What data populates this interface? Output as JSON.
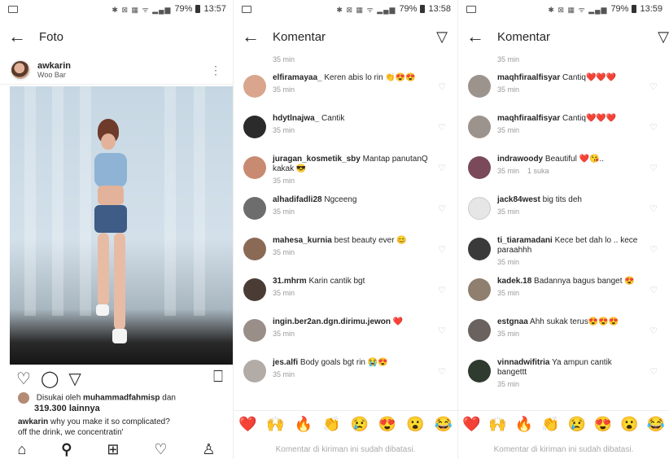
{
  "status": {
    "panel1": {
      "battery": "79%",
      "time": "13:57"
    },
    "panel2": {
      "battery": "79%",
      "time": "13:58"
    },
    "panel3": {
      "battery": "79%",
      "time": "13:59"
    }
  },
  "panel1": {
    "title": "Foto",
    "post": {
      "username": "awkarin",
      "location": "Woo Bar",
      "liked_by_prefix": "Disukai oleh",
      "liked_by_user": "muhammadfahmisp",
      "liked_by_and": "dan",
      "likes_count": "319.300 lainnya",
      "caption_user": "awkarin",
      "caption_text": "why you make it so complicated?",
      "caption_line2": "off the drink, we concentratin'"
    }
  },
  "panel2": {
    "title": "Komentar",
    "partial_time": "35 min",
    "comments": [
      {
        "user": "elfiramayaa_",
        "text": "Keren abis lo rin 👏😍😍",
        "time": "35 min",
        "avatar_color": "#d9a58c"
      },
      {
        "user": "hdytlnajwa_",
        "text": "Cantik",
        "time": "35 min",
        "avatar_color": "#2b2b2b"
      },
      {
        "user": "juragan_kosmetik_sby",
        "text": "Mantap panutanQ kakak 😎",
        "time": "35 min",
        "avatar_color": "#c98a72"
      },
      {
        "user": "alhadifadli28",
        "text": "Ngceeng",
        "time": "35 min",
        "avatar_color": "#6d6d6d"
      },
      {
        "user": "mahesa_kurnia",
        "text": "best beauty ever 😊",
        "time": "35 min",
        "avatar_color": "#8a6a55"
      },
      {
        "user": "31.mhrm",
        "text": "Karin cantik bgt",
        "time": "35 min",
        "avatar_color": "#4a3b35"
      },
      {
        "user": "ingin.ber2an.dgn.dirimu.jewon",
        "text": "❤️",
        "time": "35 min",
        "avatar_color": "#9a8e88"
      },
      {
        "user": "jes.alfi",
        "text": "Body goals bgt rin 😭😍",
        "time": "35 min",
        "avatar_color": "#b3aba6"
      }
    ],
    "emojis": [
      "❤️",
      "🙌",
      "🔥",
      "👏",
      "😢",
      "😍",
      "😮",
      "😂"
    ],
    "disabled_note": "Komentar di kiriman ini sudah dibatasi."
  },
  "panel3": {
    "title": "Komentar",
    "partial_time": "35 min",
    "comments": [
      {
        "user": "maqhfiraalfisyar",
        "text": "Cantiq❤️❤️❤️",
        "time": "35 min",
        "likes": "",
        "avatar_color": "#9d938d"
      },
      {
        "user": "maqhfiraalfisyar",
        "text": "Cantiq❤️❤️❤️",
        "time": "35 min",
        "likes": "",
        "avatar_color": "#9d938d"
      },
      {
        "user": "indrawoody",
        "text": "Beautiful ❤️😘..",
        "time": "35 min",
        "likes": "1 suka",
        "avatar_color": "#7a4a5a"
      },
      {
        "user": "jack84west",
        "text": "big tits deh",
        "time": "35 min",
        "likes": "",
        "avatar_color": "#e6e6e6"
      },
      {
        "user": "ti_tiaramadani",
        "text": "Kece bet dah lo .. kece paraahhh",
        "time": "35 min",
        "likes": "",
        "avatar_color": "#3a3a3a"
      },
      {
        "user": "kadek.18",
        "text": "Badannya bagus banget 😍",
        "time": "35 min",
        "likes": "",
        "avatar_color": "#8f7f6f"
      },
      {
        "user": "estgnaa",
        "text": "Ahh sukak terus😍😍😍",
        "time": "35 min",
        "likes": "",
        "avatar_color": "#6a625e"
      },
      {
        "user": "vinnadwifitria",
        "text": "Ya ampun cantik bangettt",
        "time": "35 min",
        "likes": "",
        "avatar_color": "#2e3b2e"
      }
    ],
    "emojis": [
      "❤️",
      "🙌",
      "🔥",
      "👏",
      "😢",
      "😍",
      "😮",
      "😂"
    ],
    "disabled_note": "Komentar di kiriman ini sudah dibatasi."
  }
}
